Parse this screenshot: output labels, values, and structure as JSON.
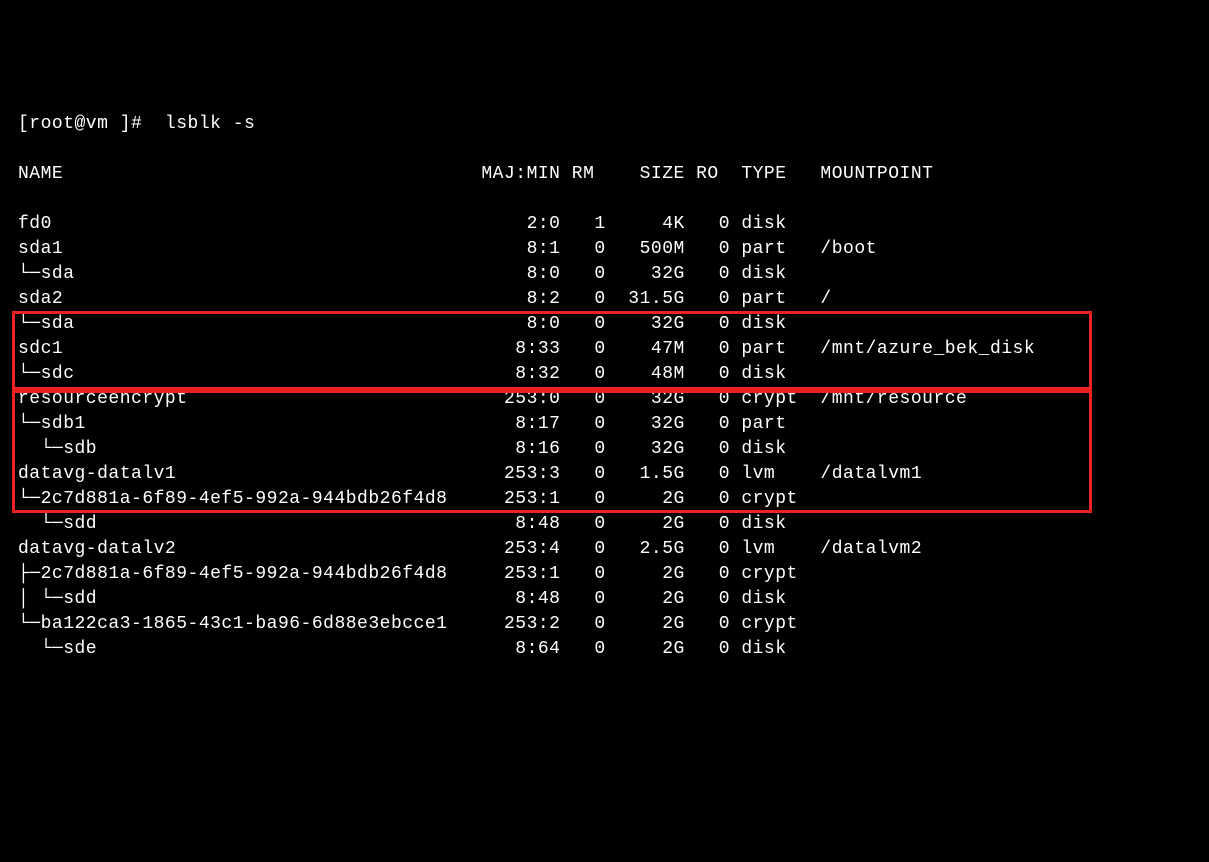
{
  "prompt": "[root@vm ]#  lsblk -s",
  "header": {
    "name": "NAME",
    "majmin": "MAJ:MIN",
    "rm": "RM",
    "size": "SIZE",
    "ro": "RO",
    "type": "TYPE",
    "mount": "MOUNTPOINT"
  },
  "rows": [
    {
      "name": "fd0",
      "majmin": "2:0",
      "rm": "1",
      "size": "4K",
      "ro": "0",
      "type": "disk",
      "mount": ""
    },
    {
      "name": "sda1",
      "majmin": "8:1",
      "rm": "0",
      "size": "500M",
      "ro": "0",
      "type": "part",
      "mount": "/boot"
    },
    {
      "name": "└─sda",
      "majmin": "8:0",
      "rm": "0",
      "size": "32G",
      "ro": "0",
      "type": "disk",
      "mount": ""
    },
    {
      "name": "sda2",
      "majmin": "8:2",
      "rm": "0",
      "size": "31.5G",
      "ro": "0",
      "type": "part",
      "mount": "/"
    },
    {
      "name": "└─sda",
      "majmin": "8:0",
      "rm": "0",
      "size": "32G",
      "ro": "0",
      "type": "disk",
      "mount": ""
    },
    {
      "name": "sdc1",
      "majmin": "8:33",
      "rm": "0",
      "size": "47M",
      "ro": "0",
      "type": "part",
      "mount": "/mnt/azure_bek_disk"
    },
    {
      "name": "└─sdc",
      "majmin": "8:32",
      "rm": "0",
      "size": "48M",
      "ro": "0",
      "type": "disk",
      "mount": ""
    },
    {
      "name": "resourceencrypt",
      "majmin": "253:0",
      "rm": "0",
      "size": "32G",
      "ro": "0",
      "type": "crypt",
      "mount": "/mnt/resource"
    },
    {
      "name": "└─sdb1",
      "majmin": "8:17",
      "rm": "0",
      "size": "32G",
      "ro": "0",
      "type": "part",
      "mount": ""
    },
    {
      "name": "  └─sdb",
      "majmin": "8:16",
      "rm": "0",
      "size": "32G",
      "ro": "0",
      "type": "disk",
      "mount": ""
    },
    {
      "name": "datavg-datalv1",
      "majmin": "253:3",
      "rm": "0",
      "size": "1.5G",
      "ro": "0",
      "type": "lvm",
      "mount": "/datalvm1"
    },
    {
      "name": "└─2c7d881a-6f89-4ef5-992a-944bdb26f4d8",
      "majmin": "253:1",
      "rm": "0",
      "size": "2G",
      "ro": "0",
      "type": "crypt",
      "mount": ""
    },
    {
      "name": "  └─sdd",
      "majmin": "8:48",
      "rm": "0",
      "size": "2G",
      "ro": "0",
      "type": "disk",
      "mount": ""
    },
    {
      "name": "datavg-datalv2",
      "majmin": "253:4",
      "rm": "0",
      "size": "2.5G",
      "ro": "0",
      "type": "lvm",
      "mount": "/datalvm2"
    },
    {
      "name": "├─2c7d881a-6f89-4ef5-992a-944bdb26f4d8",
      "majmin": "253:1",
      "rm": "0",
      "size": "2G",
      "ro": "0",
      "type": "crypt",
      "mount": ""
    },
    {
      "name": "│ └─sdd",
      "majmin": "8:48",
      "rm": "0",
      "size": "2G",
      "ro": "0",
      "type": "disk",
      "mount": ""
    },
    {
      "name": "└─ba122ca3-1865-43c1-ba96-6d88e3ebcce1",
      "majmin": "253:2",
      "rm": "0",
      "size": "2G",
      "ro": "0",
      "type": "crypt",
      "mount": ""
    },
    {
      "name": "  └─sde",
      "majmin": "8:64",
      "rm": "0",
      "size": "2G",
      "ro": "0",
      "type": "disk",
      "mount": ""
    }
  ],
  "chart_data": {
    "type": "table",
    "title": "lsblk -s output",
    "columns": [
      "NAME",
      "MAJ:MIN",
      "RM",
      "SIZE",
      "RO",
      "TYPE",
      "MOUNTPOINT"
    ],
    "rows": [
      [
        "fd0",
        "2:0",
        "1",
        "4K",
        "0",
        "disk",
        ""
      ],
      [
        "sda1",
        "8:1",
        "0",
        "500M",
        "0",
        "part",
        "/boot"
      ],
      [
        "└─sda",
        "8:0",
        "0",
        "32G",
        "0",
        "disk",
        ""
      ],
      [
        "sda2",
        "8:2",
        "0",
        "31.5G",
        "0",
        "part",
        "/"
      ],
      [
        "└─sda",
        "8:0",
        "0",
        "32G",
        "0",
        "disk",
        ""
      ],
      [
        "sdc1",
        "8:33",
        "0",
        "47M",
        "0",
        "part",
        "/mnt/azure_bek_disk"
      ],
      [
        "└─sdc",
        "8:32",
        "0",
        "48M",
        "0",
        "disk",
        ""
      ],
      [
        "resourceencrypt",
        "253:0",
        "0",
        "32G",
        "0",
        "crypt",
        "/mnt/resource"
      ],
      [
        "└─sdb1",
        "8:17",
        "0",
        "32G",
        "0",
        "part",
        ""
      ],
      [
        "  └─sdb",
        "8:16",
        "0",
        "32G",
        "0",
        "disk",
        ""
      ],
      [
        "datavg-datalv1",
        "253:3",
        "0",
        "1.5G",
        "0",
        "lvm",
        "/datalvm1"
      ],
      [
        "└─2c7d881a-6f89-4ef5-992a-944bdb26f4d8",
        "253:1",
        "0",
        "2G",
        "0",
        "crypt",
        ""
      ],
      [
        "  └─sdd",
        "8:48",
        "0",
        "2G",
        "0",
        "disk",
        ""
      ],
      [
        "datavg-datalv2",
        "253:4",
        "0",
        "2.5G",
        "0",
        "lvm",
        "/datalvm2"
      ],
      [
        "├─2c7d881a-6f89-4ef5-992a-944bdb26f4d8",
        "253:1",
        "0",
        "2G",
        "0",
        "crypt",
        ""
      ],
      [
        "│ └─sdd",
        "8:48",
        "0",
        "2G",
        "0",
        "disk",
        ""
      ],
      [
        "└─ba122ca3-1865-43c1-ba96-6d88e3ebcce1",
        "253:2",
        "0",
        "2G",
        "0",
        "crypt",
        ""
      ],
      [
        "  └─sde",
        "8:64",
        "0",
        "2G",
        "0",
        "disk",
        ""
      ]
    ]
  }
}
